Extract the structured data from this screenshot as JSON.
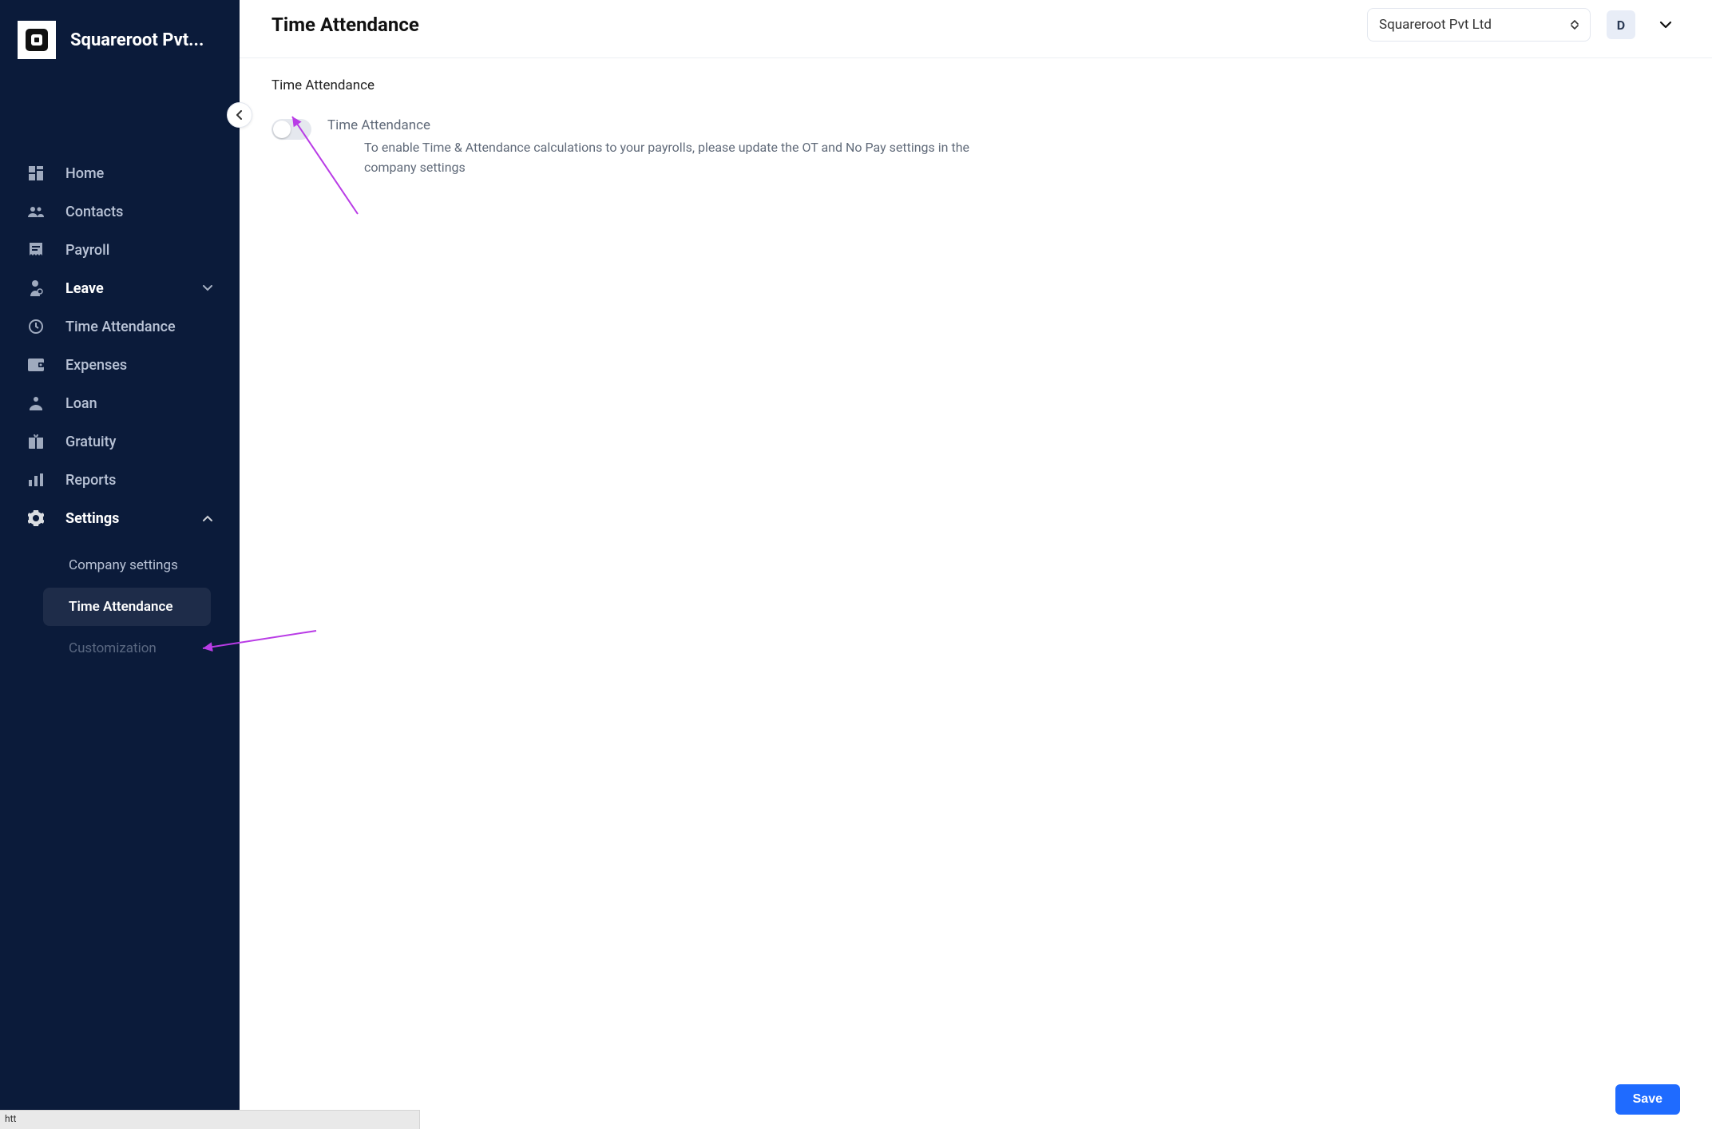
{
  "brand": {
    "name": "Squareroot Pvt..."
  },
  "sidebar": {
    "items": [
      {
        "label": "Home"
      },
      {
        "label": "Contacts"
      },
      {
        "label": "Payroll"
      },
      {
        "label": "Leave"
      },
      {
        "label": "Time Attendance"
      },
      {
        "label": "Expenses"
      },
      {
        "label": "Loan"
      },
      {
        "label": "Gratuity"
      },
      {
        "label": "Reports"
      },
      {
        "label": "Settings"
      }
    ],
    "settings_sub": [
      {
        "label": "Company settings"
      },
      {
        "label": "Time Attendance"
      },
      {
        "label": "Customization"
      }
    ]
  },
  "topbar": {
    "title": "Time Attendance",
    "org": "Squareroot Pvt Ltd",
    "avatar": "D"
  },
  "content": {
    "section_title": "Time Attendance",
    "toggle_label": "Time Attendance",
    "toggle_desc": "To enable Time & Attendance calculations to your payrolls, please update the OT and No Pay settings in the company settings"
  },
  "footer": {
    "save": "Save"
  },
  "status": {
    "text": "htt"
  },
  "colors": {
    "sidebar_bg": "#0b1b3a",
    "accent": "#1f6bff",
    "arrow": "#b93ce6"
  }
}
